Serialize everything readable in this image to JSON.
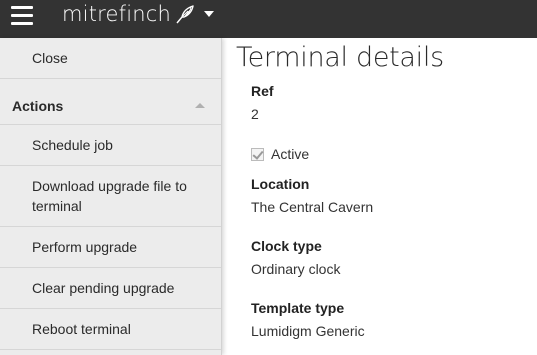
{
  "header": {
    "brand": "mitrefinch",
    "brand_icon": "bird-quill-icon",
    "menu_icon": "hamburger-icon"
  },
  "sidebar": {
    "close_label": "Close",
    "section_title": "Actions",
    "items": [
      {
        "label": "Schedule job"
      },
      {
        "label": "Download upgrade file to terminal"
      },
      {
        "label": "Perform upgrade"
      },
      {
        "label": "Clear pending upgrade"
      },
      {
        "label": "Reboot terminal"
      }
    ]
  },
  "main": {
    "title": "Terminal details",
    "ref_label": "Ref",
    "ref_value": "2",
    "active_label": "Active",
    "active_checked": true,
    "location_label": "Location",
    "location_value": "The Central Cavern",
    "clock_type_label": "Clock type",
    "clock_type_value": "Ordinary clock",
    "template_type_label": "Template type",
    "template_type_value": "Lumidigm Generic"
  },
  "colors": {
    "topbar": "#333333",
    "sidebar_bg": "#ececec",
    "page_bg": "#ffffff"
  }
}
